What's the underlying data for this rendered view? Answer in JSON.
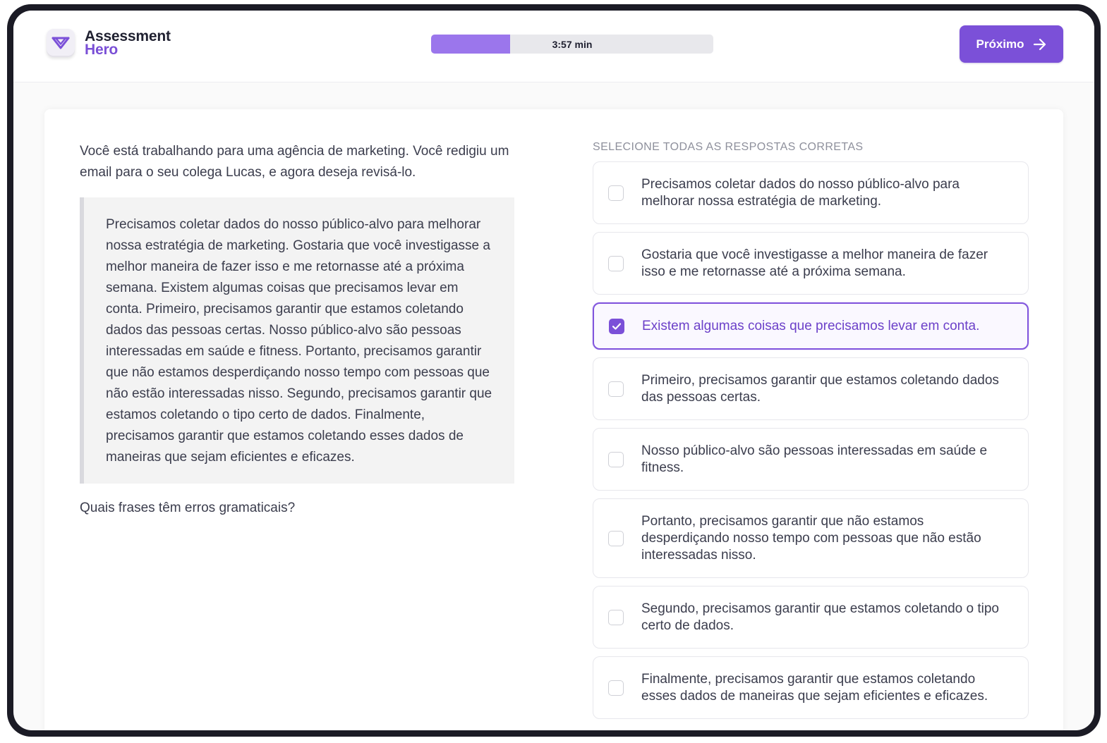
{
  "brand": {
    "name_line1": "Assessment",
    "name_line2": "Hero",
    "logo_icon": "heart-check-icon"
  },
  "timer": {
    "label": "3:57 min",
    "progress_fraction": 0.28
  },
  "next_button": {
    "label": "Próximo",
    "icon": "arrow-right-icon"
  },
  "colors": {
    "accent": "#7b50d8",
    "progress_fill": "#9b76ec",
    "brand_text": "#7a4fd6"
  },
  "passage": {
    "intro": "Você está trabalhando para uma agência de marketing. Você redigiu um email para o seu colega Lucas, e agora deseja revisá-lo.",
    "email": "Precisamos coletar dados do nosso público-alvo para melhorar nossa estratégia de marketing. Gostaria que você investigasse a melhor maneira de fazer isso e me retornasse até a próxima semana. Existem algumas coisas que precisamos levar em conta. Primeiro, precisamos garantir que estamos coletando dados das pessoas certas. Nosso público-alvo são pessoas interessadas em saúde e fitness. Portanto, precisamos garantir que não estamos desperdiçando nosso tempo com pessoas que não estão interessadas nisso. Segundo, precisamos garantir que estamos coletando o tipo certo de dados. Finalmente, precisamos garantir que estamos coletando esses dados de maneiras que sejam eficientes e eficazes.",
    "question": "Quais frases têm erros gramaticais?"
  },
  "answers": {
    "instruction": "Selecione todas as respostas corretas",
    "options": [
      {
        "text": "Precisamos coletar dados do nosso público-alvo para melhorar nossa estratégia de marketing.",
        "checked": false
      },
      {
        "text": "Gostaria que você investigasse a melhor maneira de fazer isso e me retornasse até a próxima semana.",
        "checked": false
      },
      {
        "text": "Existem algumas coisas que precisamos levar em conta.",
        "checked": true
      },
      {
        "text": "Primeiro, precisamos garantir que estamos coletando dados das pessoas certas.",
        "checked": false
      },
      {
        "text": "Nosso público-alvo são pessoas interessadas em saúde e fitness.",
        "checked": false
      },
      {
        "text": "Portanto, precisamos garantir que não estamos desperdiçando nosso tempo com pessoas que não estão interessadas nisso.",
        "checked": false
      },
      {
        "text": "Segundo, precisamos garantir que estamos coletando o tipo certo de dados.",
        "checked": false
      },
      {
        "text": "Finalmente, precisamos garantir que estamos coletando esses dados de maneiras que sejam eficientes e eficazes.",
        "checked": false
      }
    ]
  }
}
